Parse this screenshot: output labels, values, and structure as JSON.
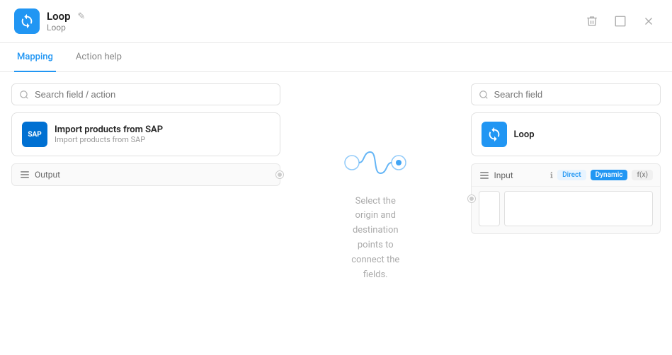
{
  "header": {
    "app_icon_label": "loop",
    "title": "Loop",
    "subtitle": "Loop",
    "actions": {
      "delete_label": "delete",
      "expand_label": "expand",
      "close_label": "close"
    }
  },
  "tabs": [
    {
      "id": "mapping",
      "label": "Mapping",
      "active": true
    },
    {
      "id": "action-help",
      "label": "Action help",
      "active": false
    }
  ],
  "left_panel": {
    "search_placeholder": "Search field / action",
    "source_card": {
      "title": "Import products from SAP",
      "subtitle": "Import products from SAP"
    },
    "output_row": {
      "label": "Output"
    }
  },
  "right_panel": {
    "search_placeholder": "Search field",
    "loop_card": {
      "title": "Loop"
    },
    "input_row": {
      "label": "Input",
      "badges": {
        "direct": "Direct",
        "dynamic": "Dynamic",
        "fx": "f(x)"
      }
    }
  },
  "center": {
    "hint_line1": "Select the",
    "hint_line2": "origin and",
    "hint_line3": "destination",
    "hint_line4": "points to",
    "hint_line5": "connect the",
    "hint_line6": "fields."
  }
}
